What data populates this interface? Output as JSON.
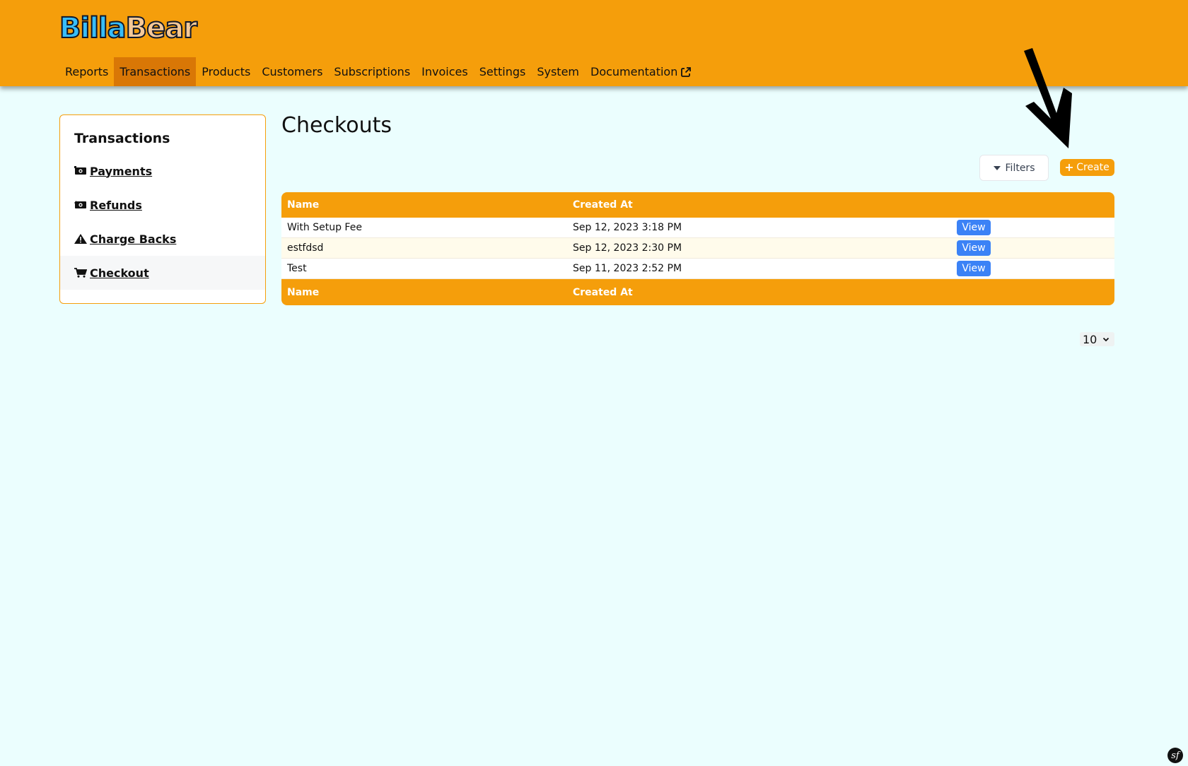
{
  "brand": {
    "part1": "Billa",
    "part2": "Bear"
  },
  "nav": {
    "items": [
      {
        "label": "Reports"
      },
      {
        "label": "Transactions"
      },
      {
        "label": "Products"
      },
      {
        "label": "Customers"
      },
      {
        "label": "Subscriptions"
      },
      {
        "label": "Invoices"
      },
      {
        "label": "Settings"
      },
      {
        "label": "System"
      },
      {
        "label": "Documentation"
      }
    ],
    "active": "Transactions"
  },
  "sidebar": {
    "title": "Transactions",
    "items": [
      {
        "label": "Payments",
        "icon": "money-bill-icon"
      },
      {
        "label": "Refunds",
        "icon": "money-bill-refund-icon"
      },
      {
        "label": "Charge Backs",
        "icon": "warning-icon"
      },
      {
        "label": "Checkout",
        "icon": "cart-icon"
      }
    ],
    "active": "Checkout"
  },
  "main": {
    "title": "Checkouts",
    "filters_label": "Filters",
    "create_label": "Create",
    "table": {
      "columns": [
        "Name",
        "Created At"
      ],
      "rows": [
        {
          "name": "With Setup Fee",
          "created_at": "Sep 12, 2023 3:18 PM",
          "action": "View"
        },
        {
          "name": "estfdsd",
          "created_at": "Sep 12, 2023 2:30 PM",
          "action": "View"
        },
        {
          "name": "Test",
          "created_at": "Sep 11, 2023 2:52 PM",
          "action": "View"
        }
      ]
    },
    "per_page": "10"
  },
  "colors": {
    "accent": "#f59e0b",
    "accent_dark": "#d97706",
    "background": "#ebfefe",
    "button_blue": "#3b82f6"
  }
}
